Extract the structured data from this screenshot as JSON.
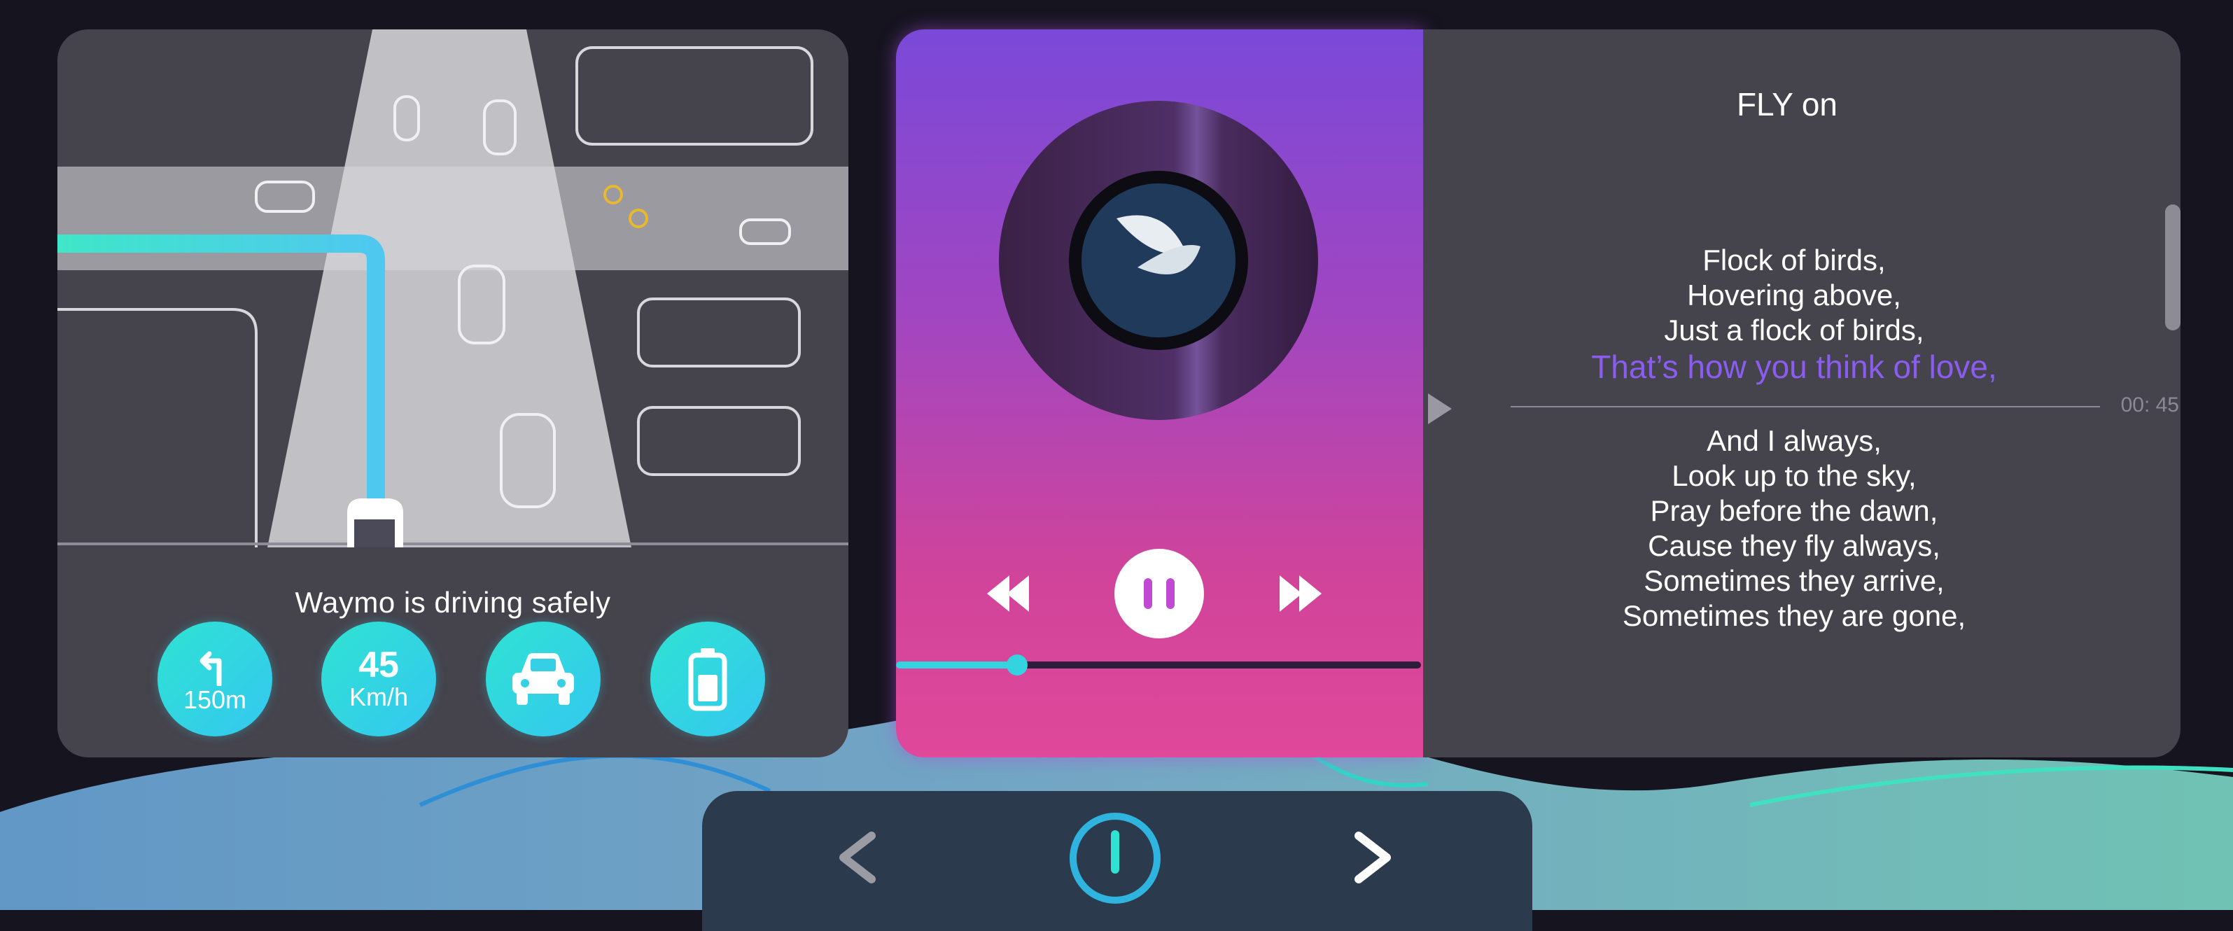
{
  "navigation": {
    "status_text": "Waymo is driving safely",
    "turn": {
      "icon": "turn-left-arrow-icon",
      "distance": "150m"
    },
    "speed": {
      "value": "45",
      "unit": "Km/h"
    },
    "vehicle_icon": "car-icon",
    "battery_icon": "battery-icon"
  },
  "music": {
    "album_art_icon": "feather-icon",
    "controls": {
      "previous_icon": "rewind-icon",
      "pause_icon": "pause-icon",
      "next_icon": "fast-forward-icon"
    },
    "progress_fraction": 0.23
  },
  "lyrics": {
    "song_title": "FLY on",
    "lines_before": [
      "Flock of birds,",
      "Hovering above,",
      "Just a flock of birds,"
    ],
    "current_line": "That’s how you think of love,",
    "current_time": "00: 45",
    "lines_after": [
      "And I always,",
      "Look up to the sky,",
      "Pray before the dawn,",
      "Cause they fly always,",
      "Sometimes they arrive,",
      "Sometimes they are gone,"
    ]
  },
  "bottom_bar": {
    "back_icon": "chevron-left-icon",
    "power_icon": "power-icon",
    "forward_icon": "chevron-right-icon"
  },
  "colors": {
    "accent_cyan": "#33d4e0",
    "route_blue": "#4fc8f0",
    "lyric_highlight": "#8a5df0",
    "card_bg": "#45434c",
    "page_bg": "#16141f"
  }
}
